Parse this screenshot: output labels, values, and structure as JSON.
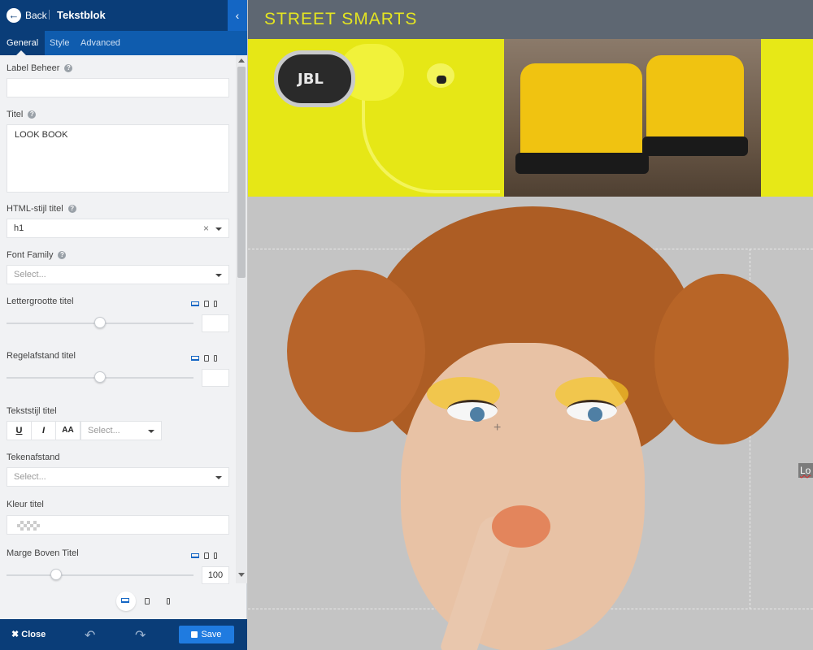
{
  "topbar": {
    "back_label": "Back",
    "title": "Tekstblok",
    "back_icon": "arrow-left-icon",
    "collapse_icon": "chevron-left-icon"
  },
  "tabs": [
    {
      "label": "General",
      "active": true
    },
    {
      "label": "Style",
      "active": false
    },
    {
      "label": "Advanced",
      "active": false
    }
  ],
  "fields": {
    "label_beheer": {
      "label": "Label Beheer",
      "value": ""
    },
    "titel": {
      "label": "Titel",
      "value": "LOOK BOOK"
    },
    "html_stijl": {
      "label": "HTML-stijl titel",
      "value": "h1"
    },
    "font_family": {
      "label": "Font Family",
      "placeholder": "Select..."
    },
    "lettergrootte": {
      "label": "Lettergrootte titel",
      "value": ""
    },
    "regelafstand": {
      "label": "Regelafstand titel",
      "value": ""
    },
    "tekststijl": {
      "label": "Tekststijl titel",
      "underline": "U",
      "italic": "I",
      "caps": "AA",
      "placeholder": "Select..."
    },
    "tekenafstand": {
      "label": "Tekenafstand",
      "placeholder": "Select..."
    },
    "kleur": {
      "label": "Kleur titel"
    },
    "marge_boven": {
      "label": "Marge Boven Titel",
      "value": "100"
    }
  },
  "footer": {
    "close_label": "Close",
    "save_label": "Save",
    "undo_icon": "undo-icon",
    "redo_icon": "redo-icon"
  },
  "canvas": {
    "site_title": "STREET SMARTS",
    "banner_brand": "JBL",
    "hero_chip": "Lo"
  },
  "colors": {
    "sidebar_dark": "#0a3d78",
    "tab_bar": "#0f5cae",
    "accent": "#1f7be0",
    "banner_yellow": "#e7e817",
    "site_title": "#e4e521"
  }
}
